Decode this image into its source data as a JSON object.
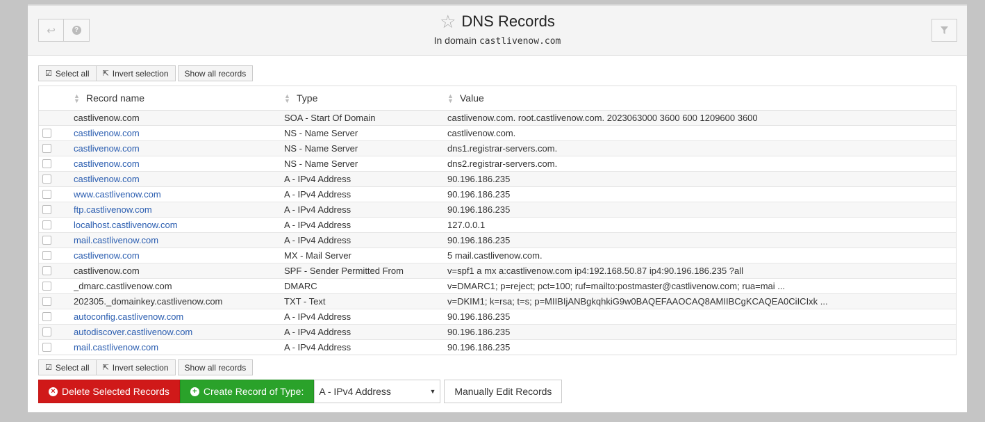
{
  "header": {
    "title": "DNS Records",
    "subtitle_prefix": "In domain",
    "domain": "castlivenow.com"
  },
  "toolbar": {
    "select_all": "Select all",
    "invert_selection": "Invert selection",
    "show_all": "Show all records"
  },
  "table": {
    "columns": [
      "Record name",
      "Type",
      "Value"
    ],
    "rows": [
      {
        "name": "castlivenow.com",
        "type": "SOA - Start Of Domain",
        "value": "castlivenow.com. root.castlivenow.com. 2023063000 3600 600 1209600 3600",
        "link": false,
        "checkbox": false
      },
      {
        "name": "castlivenow.com",
        "type": "NS - Name Server",
        "value": "castlivenow.com.",
        "link": true,
        "checkbox": true
      },
      {
        "name": "castlivenow.com",
        "type": "NS - Name Server",
        "value": "dns1.registrar-servers.com.",
        "link": true,
        "checkbox": true
      },
      {
        "name": "castlivenow.com",
        "type": "NS - Name Server",
        "value": "dns2.registrar-servers.com.",
        "link": true,
        "checkbox": true
      },
      {
        "name": "castlivenow.com",
        "type": "A - IPv4 Address",
        "value": "90.196.186.235",
        "link": true,
        "checkbox": true
      },
      {
        "name": "www.castlivenow.com",
        "type": "A - IPv4 Address",
        "value": "90.196.186.235",
        "link": true,
        "checkbox": true
      },
      {
        "name": "ftp.castlivenow.com",
        "type": "A - IPv4 Address",
        "value": "90.196.186.235",
        "link": true,
        "checkbox": true
      },
      {
        "name": "localhost.castlivenow.com",
        "type": "A - IPv4 Address",
        "value": "127.0.0.1",
        "link": true,
        "checkbox": true
      },
      {
        "name": "mail.castlivenow.com",
        "type": "A - IPv4 Address",
        "value": "90.196.186.235",
        "link": true,
        "checkbox": true
      },
      {
        "name": "castlivenow.com",
        "type": "MX - Mail Server",
        "value": "5 mail.castlivenow.com.",
        "link": true,
        "checkbox": true
      },
      {
        "name": "castlivenow.com",
        "type": "SPF - Sender Permitted From",
        "value": "v=spf1 a mx a:castlivenow.com ip4:192.168.50.87 ip4:90.196.186.235 ?all",
        "link": false,
        "checkbox": true
      },
      {
        "name": "_dmarc.castlivenow.com",
        "type": "DMARC",
        "value": "v=DMARC1; p=reject; pct=100; ruf=mailto:postmaster@castlivenow.com; rua=mai ...",
        "link": false,
        "checkbox": true
      },
      {
        "name": "202305._domainkey.castlivenow.com",
        "type": "TXT - Text",
        "value": "v=DKIM1; k=rsa; t=s; p=MIIBIjANBgkqhkiG9w0BAQEFAAOCAQ8AMIIBCgKCAQEA0CiICIxk ...",
        "link": false,
        "checkbox": true
      },
      {
        "name": "autoconfig.castlivenow.com",
        "type": "A - IPv4 Address",
        "value": "90.196.186.235",
        "link": true,
        "checkbox": true
      },
      {
        "name": "autodiscover.castlivenow.com",
        "type": "A - IPv4 Address",
        "value": "90.196.186.235",
        "link": true,
        "checkbox": true
      },
      {
        "name": "mail.castlivenow.com",
        "type": "A - IPv4 Address",
        "value": "90.196.186.235",
        "link": true,
        "checkbox": true
      }
    ]
  },
  "actions": {
    "delete_label": "Delete Selected Records",
    "create_label": "Create Record of Type:",
    "record_type_selected": "A - IPv4 Address",
    "manual_edit_label": "Manually Edit Records"
  },
  "colors": {
    "link": "#2a5db0",
    "delete": "#d01919",
    "create": "#2aa22a"
  },
  "icons": [
    "return-icon",
    "help-icon",
    "star-icon",
    "filter-icon",
    "check-square-icon",
    "external-link-icon",
    "times-circle-icon",
    "plus-circle-icon",
    "caret-down-icon",
    "sort-icon"
  ]
}
